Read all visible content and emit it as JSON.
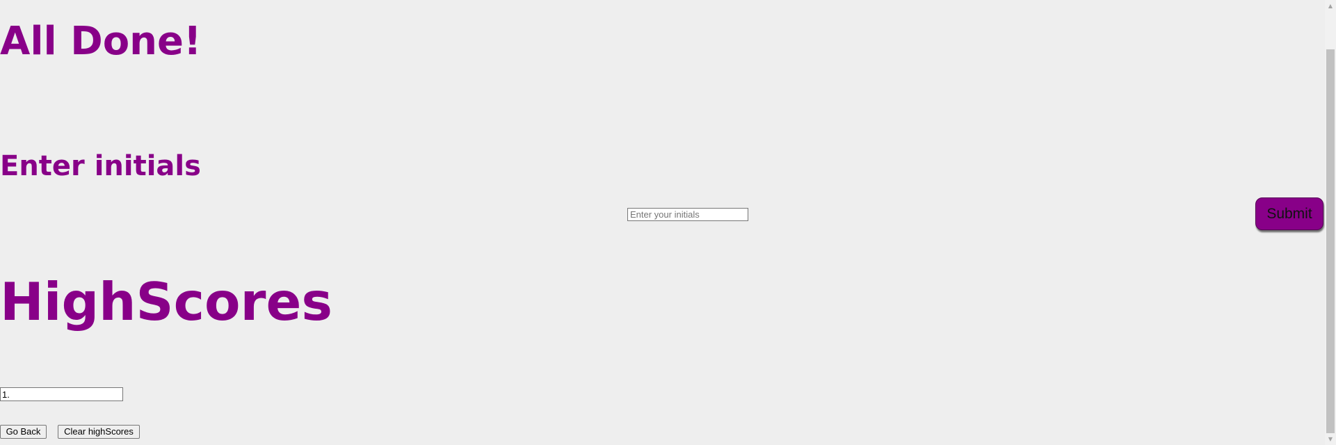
{
  "done_section": {
    "title": "All Done!"
  },
  "initials_section": {
    "heading": "Enter initials",
    "input_placeholder": "Enter your initials",
    "input_value": "",
    "submit_label": "Submit"
  },
  "highscores_section": {
    "heading": "HighScores",
    "entries": [
      "1."
    ],
    "go_back_label": "Go Back",
    "clear_label": "Clear highScores"
  },
  "colors": {
    "accent": "#880088",
    "background": "#eeeeee"
  },
  "scrollbar": {
    "up_icon": "scroll-up-arrow-icon",
    "down_icon": "scroll-down-arrow-icon"
  }
}
